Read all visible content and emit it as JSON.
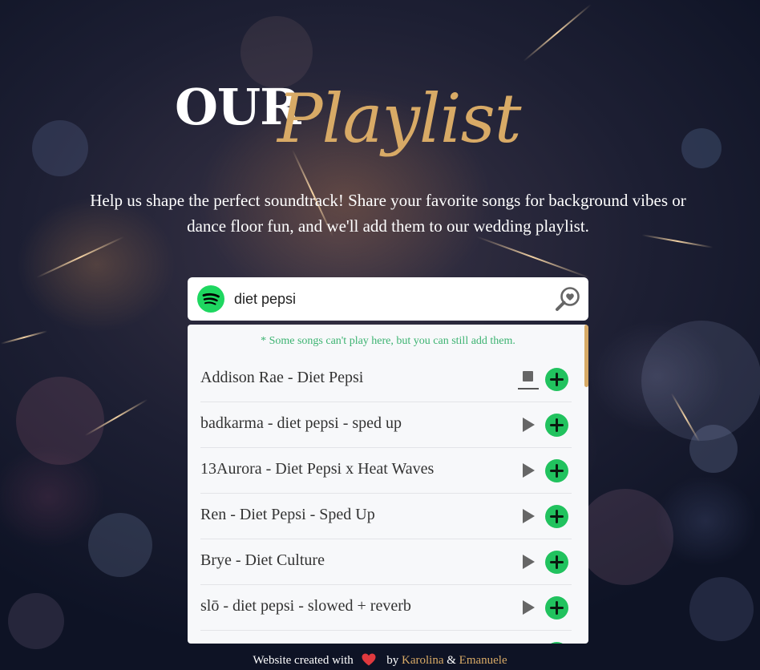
{
  "hero": {
    "title_part1": "OUR",
    "title_part2": "Playlist",
    "subtitle_line1": "Help us shape the perfect soundtrack! Share your favorite songs for background vibes or",
    "subtitle_line2": "dance floor fun, and we'll add them to our wedding playlist."
  },
  "search": {
    "value": "diet pepsi",
    "brand_icon": "spotify-icon",
    "action_icon": "search-heart-icon"
  },
  "results": {
    "note": "* Some songs can't play here, but you can still add them.",
    "songs": [
      {
        "title": "Addison Rae - Diet Pepsi",
        "state": "playing"
      },
      {
        "title": "badkarma - diet pepsi - sped up",
        "state": "paused"
      },
      {
        "title": "13Aurora - Diet Pepsi x Heat Waves",
        "state": "paused"
      },
      {
        "title": "Ren - Diet Pepsi - Sped Up",
        "state": "paused"
      },
      {
        "title": "Brye - Diet Culture",
        "state": "paused"
      },
      {
        "title": "slō - diet pepsi - slowed + reverb",
        "state": "paused"
      }
    ]
  },
  "footer": {
    "prefix": "Website created with",
    "by": "by",
    "name1": "Karolina",
    "amp": "&",
    "name2": "Emanuele"
  },
  "colors": {
    "accent_gold": "#d8aa66",
    "add_green": "#21c25e",
    "note_green": "#3cb371",
    "heart_red": "#e0393e"
  }
}
